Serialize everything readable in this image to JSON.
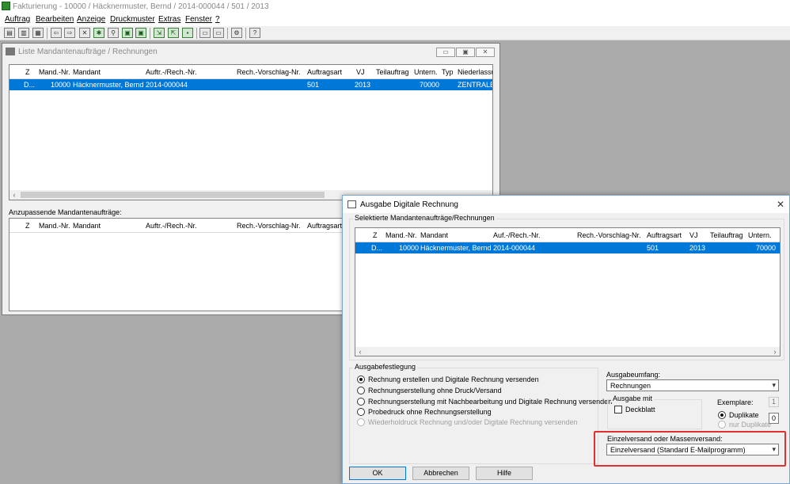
{
  "app": {
    "title": "Fakturierung - 10000 / Häcknermuster, Bernd / 2014-000044 / 501 / 2013",
    "menu": [
      "Auftrag",
      "Bearbeiten",
      "Anzeige",
      "Druckmuster",
      "Extras",
      "Fenster",
      "?"
    ]
  },
  "liste": {
    "title": "Liste Mandantenaufträge / Rechnungen",
    "columns": [
      "Z",
      "Mand.-Nr.",
      "Mandant",
      "Auftr.-/Rech.-Nr.",
      "Rech.-Vorschlag-Nr.",
      "Auftragsart",
      "VJ",
      "Teilauftrag",
      "Untern.",
      "Typ",
      "Niederlassu"
    ],
    "rows": [
      {
        "z": "D...",
        "mand_nr": "10000",
        "mandant": "Häcknermuster, Bernd",
        "nr": "2014-000044",
        "vorschlag": "",
        "auftragsart": "501",
        "vj": "2013",
        "teil": "",
        "untern": "70000",
        "typ": "",
        "niederlassung": "ZENTRALE"
      }
    ],
    "lower_label": "Anzupassende Mandantenaufträge:",
    "lower_columns": [
      "Z",
      "Mand.-Nr.",
      "Mandant",
      "Auftr.-/Rech.-Nr.",
      "Rech.-Vorschlag-Nr.",
      "Auftragsart"
    ]
  },
  "dialog": {
    "title": "Ausgabe Digitale Rechnung",
    "selected_group": "Selektierte Mandantenaufträge/Rechnungen",
    "columns": [
      "Z",
      "Mand.-Nr.",
      "Mandant",
      "Auf.-/Rech.-Nr.",
      "Rech.-Vorschlag-Nr.",
      "Auftragsart",
      "VJ",
      "Teilauftrag",
      "Untern."
    ],
    "rows": [
      {
        "z": "D...",
        "mand_nr": "10000",
        "mandant": "Häcknermuster, Bernd",
        "nr": "2014-000044",
        "vorschlag": "",
        "auftragsart": "501",
        "vj": "2013",
        "teil": "",
        "untern": "70000"
      }
    ],
    "ausgabefestlegung": {
      "label": "Ausgabefestlegung",
      "options": [
        "Rechnung erstellen und Digitale Rechnung versenden",
        "Rechnungserstellung ohne Druck/Versand",
        "Rechnungserstellung mit Nachbearbeitung und Digitale Rechnung versenden",
        "Probedruck ohne Rechnungserstellung",
        "Wiederholdruck Rechnung und/oder Digitale Rechnung versenden"
      ],
      "selected": 0
    },
    "ausgabeumfang": {
      "label": "Ausgabeumfang:",
      "value": "Rechnungen"
    },
    "ausgabe_mit": {
      "label": "Ausgabe mit",
      "deckblatt": "Deckblatt"
    },
    "exemplare": {
      "label": "Exemplare:",
      "value": "1",
      "duplikate": "Duplikate",
      "nur_duplikate": "nur Duplikate",
      "duplikate_count": "0"
    },
    "versand": {
      "label": "Einzelversand oder Massenversand:",
      "value": "Einzelversand (Standard E-Mailprogramm)"
    },
    "buttons": {
      "ok": "OK",
      "cancel": "Abbrechen",
      "help": "Hilfe"
    },
    "highlight_color": "#e03030"
  }
}
